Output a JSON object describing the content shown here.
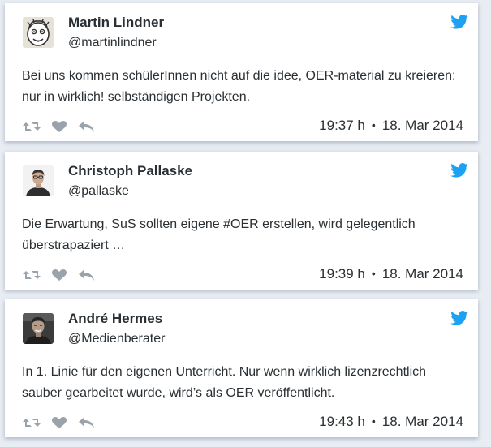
{
  "colors": {
    "accent": "#1da1f2",
    "action_gray": "#9aa2ab",
    "text": "#292f33",
    "background": "#e8ecf3"
  },
  "tweets": [
    {
      "name": "Martin Lindner",
      "handle": "@martinlindner",
      "text": "Bei uns kommen schülerInnen nicht auf die idee, OER-material zu kreieren: nur in wirklich! selbständigen Projekten.",
      "time": "19:37 h",
      "date": "18. Mar 2014",
      "avatar_icon": "cartoon-face-avatar"
    },
    {
      "name": "Christoph Pallaske",
      "handle": "@pallaske",
      "text": "Die Erwartung, SuS sollten eigene #OER erstellen, wird gelegentlich überstrapaziert …",
      "time": "19:39 h",
      "date": "18. Mar 2014",
      "avatar_icon": "person-photo-avatar"
    },
    {
      "name": "André Hermes",
      "handle": "@Medienberater",
      "text": "In 1. Linie für den eigenen Unterricht. Nur wenn wirklich lizenzrechtlich sauber gearbeitet wurde, wird’s als OER veröffentlicht.",
      "time": "19:43 h",
      "date": "18. Mar 2014",
      "avatar_icon": "person-photo-avatar"
    }
  ],
  "separator": "•",
  "icons": {
    "brand": "twitter-bird-icon",
    "retweet": "retweet-icon",
    "like": "heart-icon",
    "reply": "reply-icon"
  }
}
